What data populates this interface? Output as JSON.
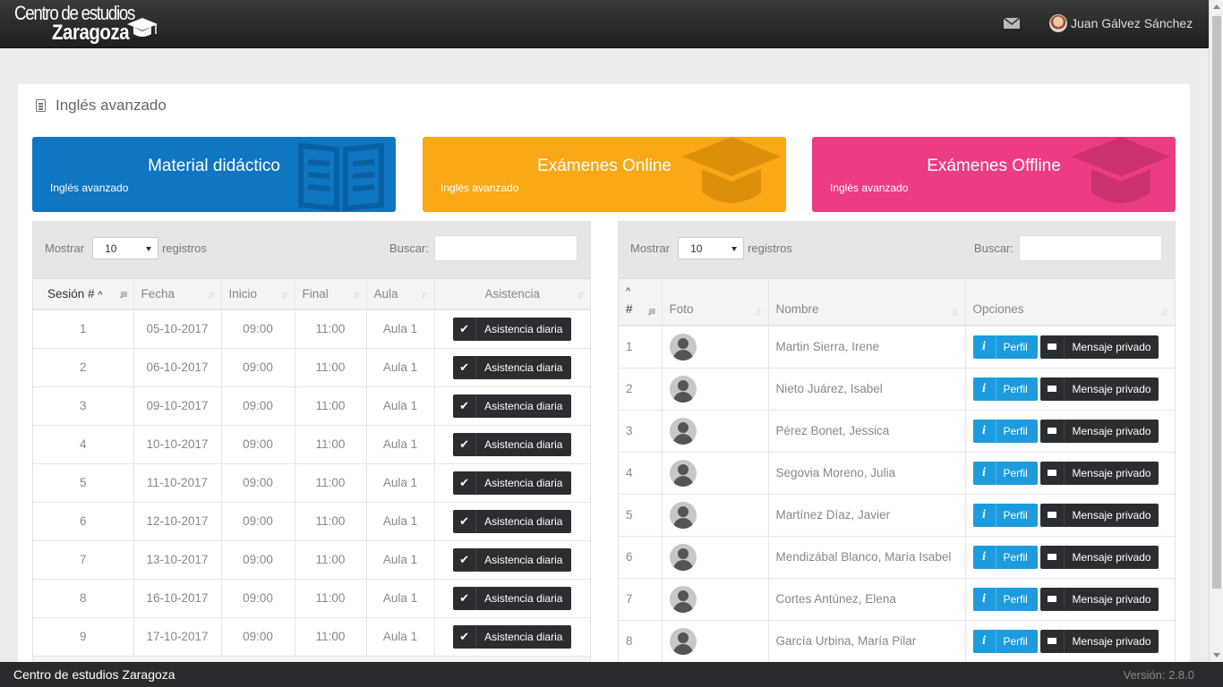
{
  "header": {
    "logo_line1": "Centro de estudios",
    "logo_line2": "Zaragoza",
    "user_name": "Juan Gálvez Sánchez"
  },
  "page": {
    "title": "Inglés avanzado"
  },
  "tiles": [
    {
      "title": "Material didáctico",
      "subtitle": "Inglés avanzado",
      "color": "#0f76c2"
    },
    {
      "title": "Exámenes Online",
      "subtitle": "Inglés avanzado",
      "color": "#fba816"
    },
    {
      "title": "Exámenes Offline",
      "subtitle": "Inglés avanzado",
      "color": "#ec3c84"
    }
  ],
  "sessions_table": {
    "show_label": "Mostrar",
    "show_value": "10",
    "records_label": "registros",
    "search_label": "Buscar:",
    "columns": [
      "Sesión #",
      "Fecha",
      "Inicio",
      "Final",
      "Aula",
      "Asistencia"
    ],
    "button_label": "Asistencia diaria",
    "rows": [
      {
        "n": "1",
        "fecha": "05-10-2017",
        "inicio": "09:00",
        "final": "11:00",
        "aula": "Aula 1"
      },
      {
        "n": "2",
        "fecha": "06-10-2017",
        "inicio": "09:00",
        "final": "11:00",
        "aula": "Aula 1"
      },
      {
        "n": "3",
        "fecha": "09-10-2017",
        "inicio": "09:00",
        "final": "11:00",
        "aula": "Aula 1"
      },
      {
        "n": "4",
        "fecha": "10-10-2017",
        "inicio": "09:00",
        "final": "11:00",
        "aula": "Aula 1"
      },
      {
        "n": "5",
        "fecha": "11-10-2017",
        "inicio": "09:00",
        "final": "11:00",
        "aula": "Aula 1"
      },
      {
        "n": "6",
        "fecha": "12-10-2017",
        "inicio": "09:00",
        "final": "11:00",
        "aula": "Aula 1"
      },
      {
        "n": "7",
        "fecha": "13-10-2017",
        "inicio": "09:00",
        "final": "11:00",
        "aula": "Aula 1"
      },
      {
        "n": "8",
        "fecha": "16-10-2017",
        "inicio": "09:00",
        "final": "11:00",
        "aula": "Aula 1"
      },
      {
        "n": "9",
        "fecha": "17-10-2017",
        "inicio": "09:00",
        "final": "11:00",
        "aula": "Aula 1"
      }
    ]
  },
  "students_table": {
    "show_label": "Mostrar",
    "show_value": "10",
    "records_label": "registros",
    "search_label": "Buscar:",
    "columns": [
      "#",
      "Foto",
      "Nombre",
      "Opciones"
    ],
    "profile_label": "Perfil",
    "message_label": "Mensaje privado",
    "rows": [
      {
        "n": "1",
        "nombre": "Martin Sierra, Irene"
      },
      {
        "n": "2",
        "nombre": "Nieto Juárez, Isabel"
      },
      {
        "n": "3",
        "nombre": "Pérez Bonet, Jessica"
      },
      {
        "n": "4",
        "nombre": "Segovia Moreno, Julia"
      },
      {
        "n": "5",
        "nombre": "Martínez Díaz, Javier"
      },
      {
        "n": "6",
        "nombre": "Mendizábal Blanco, María Isabel"
      },
      {
        "n": "7",
        "nombre": "Cortes Antúnez, Elena"
      },
      {
        "n": "8",
        "nombre": "García Urbina, María Pilar"
      }
    ]
  },
  "footer": {
    "left": "Centro de estudios Zaragoza",
    "right": "Versión: 2.8.0"
  }
}
